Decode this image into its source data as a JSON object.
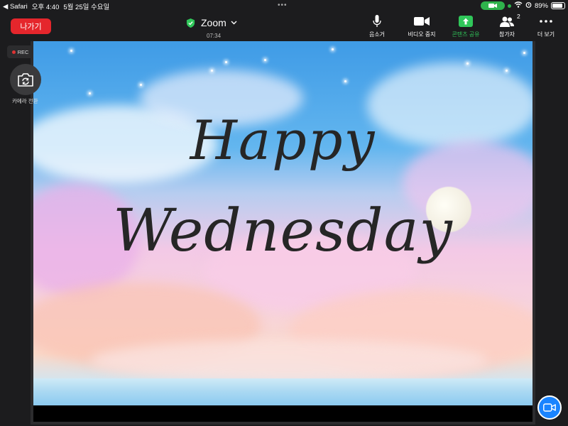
{
  "status_bar": {
    "back_app": "◀ Safari",
    "time": "오후 4:40",
    "date": "5월 25일 수요일",
    "dots": "•••",
    "battery": "89%"
  },
  "toolbar": {
    "leave_label": "나가기",
    "title": "Zoom",
    "timer": "07:34",
    "buttons": [
      {
        "label": "음소거",
        "icon": "microphone-icon"
      },
      {
        "label": "비디오 중지",
        "icon": "video-camera-icon"
      },
      {
        "label": "콘텐츠 공유",
        "icon": "share-screen-icon",
        "active": true
      },
      {
        "label": "참가자",
        "icon": "participants-icon",
        "badge": "2"
      },
      {
        "label": "더 보기",
        "icon": "more-icon"
      }
    ],
    "accent_color": "#30c75a",
    "leave_color": "#e5262c"
  },
  "side": {
    "rec_label": "REC",
    "switch_camera_label": "카메라 전환"
  },
  "shared_content": {
    "line1": "Happy",
    "line2": "Wednesday"
  }
}
